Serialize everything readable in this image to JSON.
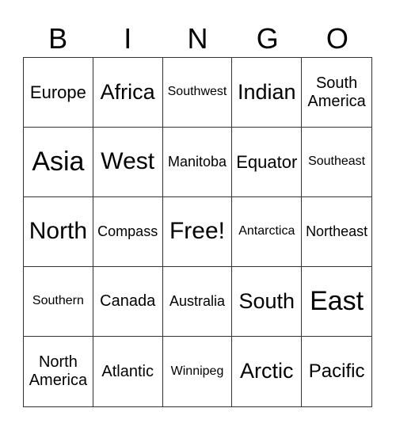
{
  "header": [
    "B",
    "I",
    "N",
    "G",
    "O"
  ],
  "cells": [
    [
      "Europe",
      "Africa",
      "Southwest",
      "Indian",
      "South America"
    ],
    [
      "Asia",
      "West",
      "Manitoba",
      "Equator",
      "Southeast"
    ],
    [
      "North",
      "Compass",
      "Free!",
      "Antarctica",
      "Northeast"
    ],
    [
      "Southern",
      "Canada",
      "Australia",
      "South",
      "East"
    ],
    [
      "North America",
      "Atlantic",
      "Winnipeg",
      "Arctic",
      "Pacific"
    ]
  ]
}
